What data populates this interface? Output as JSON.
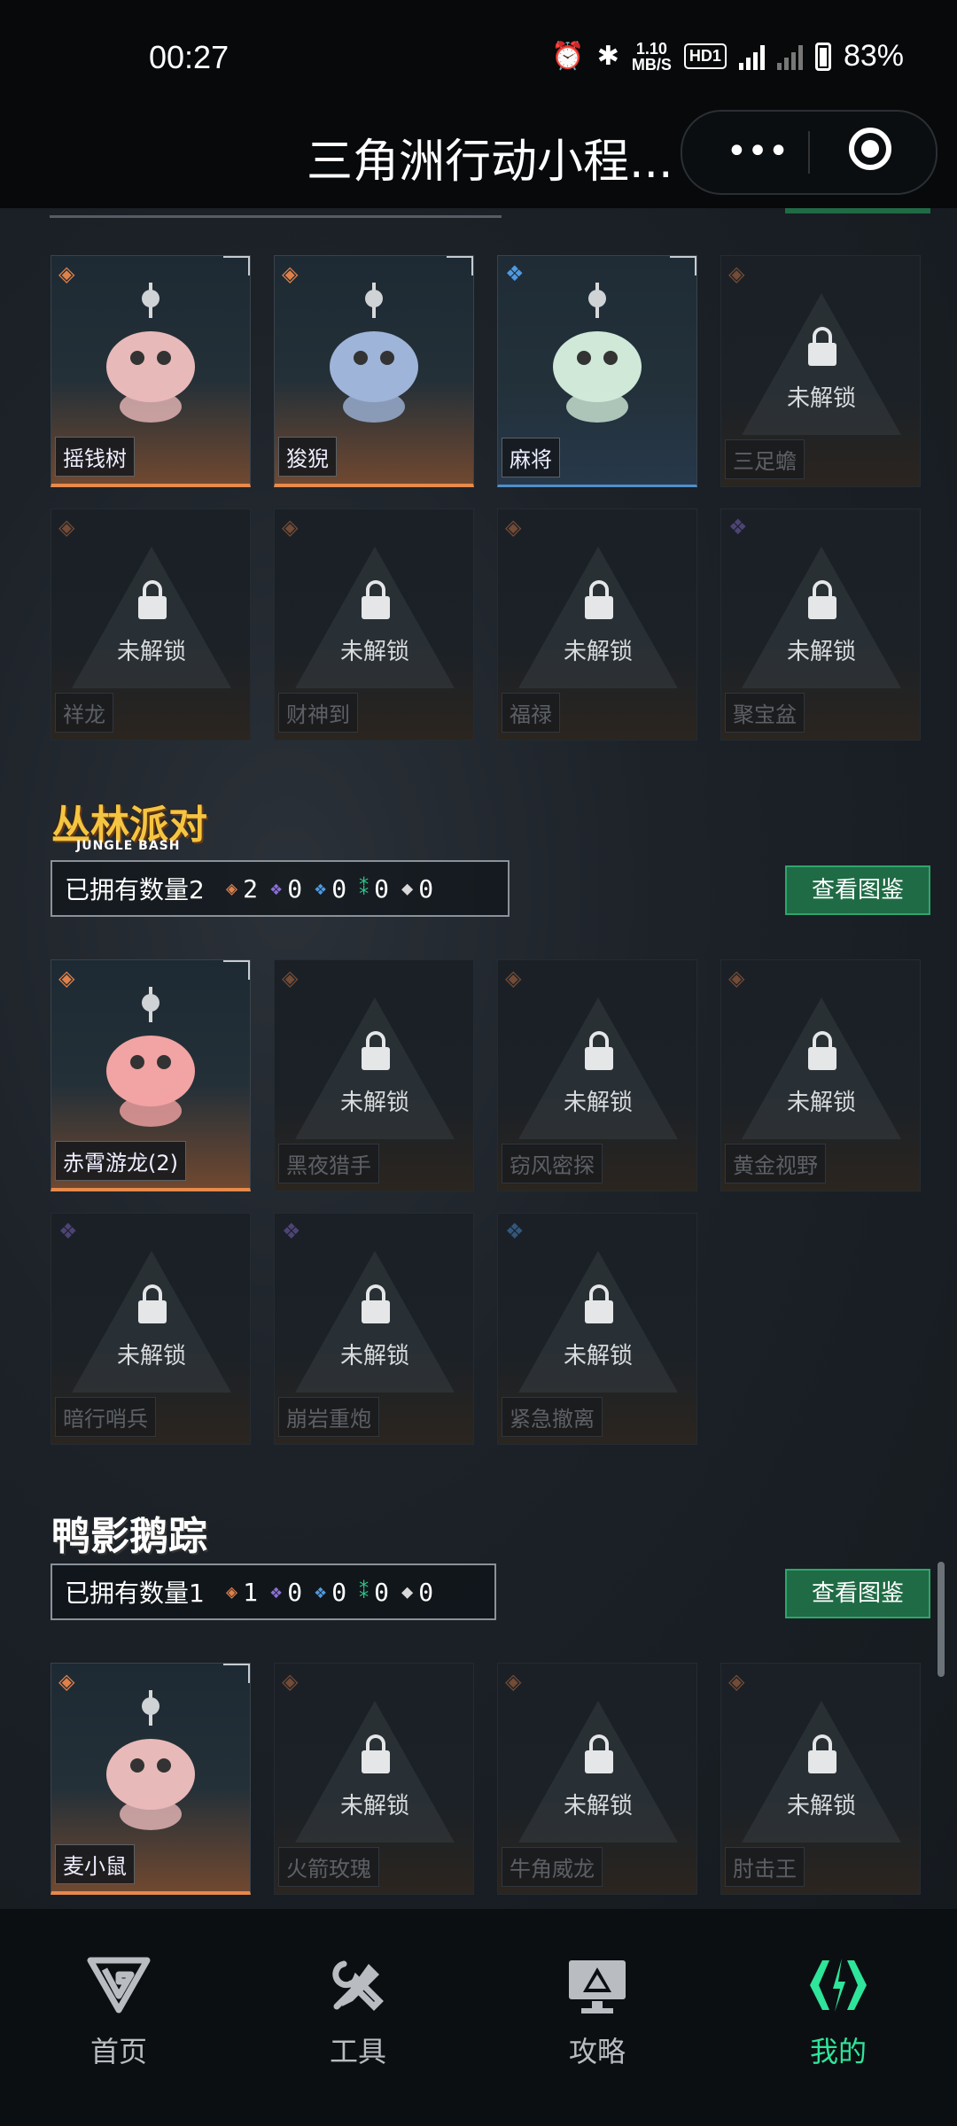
{
  "status_bar": {
    "time": "00:27",
    "speed_top": "1.10",
    "speed_unit": "MB/S",
    "hd": "HD1",
    "network": "4G",
    "battery": "83%"
  },
  "title_bar": {
    "title": "三角洲行动小程...",
    "more": "•••"
  },
  "collections": [
    {
      "name": "section-1",
      "items": [
        {
          "label": "摇钱树",
          "locked": false,
          "rarity": "orange"
        },
        {
          "label": "狻猊",
          "locked": false,
          "rarity": "orange"
        },
        {
          "label": "麻将",
          "locked": false,
          "rarity": "blue"
        },
        {
          "label": "三足蟾",
          "locked": true,
          "rarity": "orange"
        },
        {
          "label": "祥龙",
          "locked": true,
          "rarity": "orange"
        },
        {
          "label": "财神到",
          "locked": true,
          "rarity": "orange"
        },
        {
          "label": "福禄",
          "locked": true,
          "rarity": "orange"
        },
        {
          "label": "聚宝盆",
          "locked": true,
          "rarity": "purple"
        }
      ]
    },
    {
      "logo": "丛林派对",
      "logo_sub": "JUNGLE BASH",
      "count_label": "已拥有数量2",
      "counts": [
        "2",
        "0",
        "0",
        "0",
        "0"
      ],
      "gallery_button": "查看图鉴",
      "items": [
        {
          "label": "赤霄游龙(2)",
          "locked": false,
          "rarity": "orange"
        },
        {
          "label": "黑夜猎手",
          "locked": true,
          "rarity": "orange"
        },
        {
          "label": "窃风密探",
          "locked": true,
          "rarity": "orange"
        },
        {
          "label": "黄金视野",
          "locked": true,
          "rarity": "orange"
        },
        {
          "label": "暗行哨兵",
          "locked": true,
          "rarity": "purple"
        },
        {
          "label": "崩岩重炮",
          "locked": true,
          "rarity": "purple"
        },
        {
          "label": "紧急撤离",
          "locked": true,
          "rarity": "blue"
        }
      ]
    },
    {
      "logo": "鸭影鹅踪",
      "count_label": "已拥有数量1",
      "counts": [
        "1",
        "0",
        "0",
        "0",
        "0"
      ],
      "gallery_button": "查看图鉴",
      "items": [
        {
          "label": "麦小鼠",
          "locked": false,
          "rarity": "orange"
        },
        {
          "label": "火箭玫瑰",
          "locked": true,
          "rarity": "orange"
        },
        {
          "label": "牛角威龙",
          "locked": true,
          "rarity": "orange"
        },
        {
          "label": "肘击王",
          "locked": true,
          "rarity": "orange"
        }
      ]
    }
  ],
  "locked_text": "未解锁",
  "colors": {
    "orange": "#e0814a",
    "purple": "#8b6fd6",
    "blue": "#4f9ae0",
    "green": "#2fc889",
    "white": "#d8d8d8",
    "accent": "#2ee59a"
  },
  "nav": [
    {
      "label": "首页",
      "icon": "logo-icon"
    },
    {
      "label": "工具",
      "icon": "tools-icon"
    },
    {
      "label": "攻略",
      "icon": "guide-icon"
    },
    {
      "label": "我的",
      "icon": "profile-icon",
      "active": true
    }
  ]
}
